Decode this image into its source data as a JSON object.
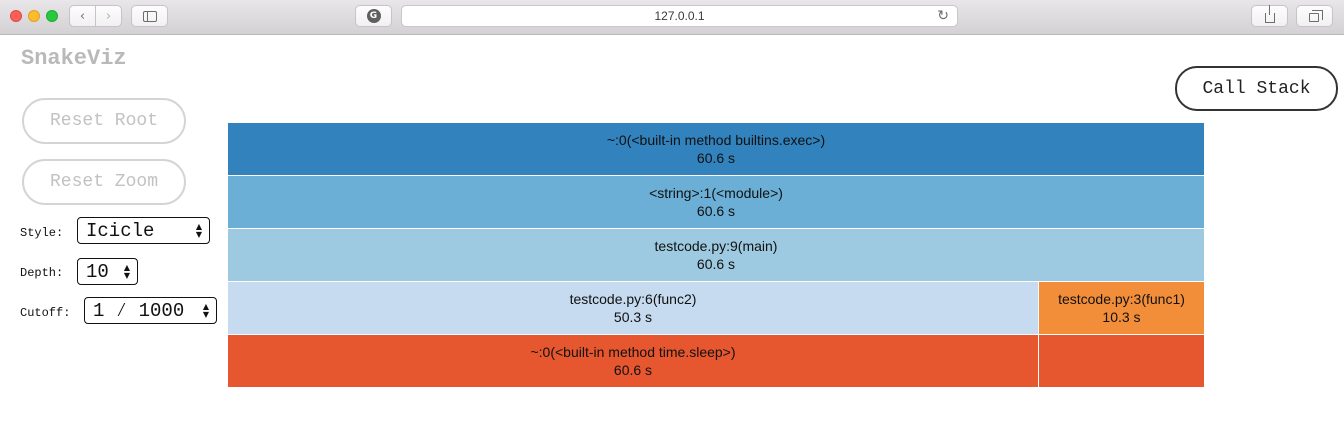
{
  "browser": {
    "address": "127.0.0.1",
    "back_icon": "‹",
    "forward_icon": "›",
    "reload_icon": "↻",
    "extension_letter": "G"
  },
  "app": {
    "title": "SnakeViz",
    "reset_root_label": "Reset Root",
    "reset_zoom_label": "Reset Zoom",
    "call_stack_label": "Call Stack"
  },
  "controls": {
    "style": {
      "label": "Style:",
      "value": "Icicle"
    },
    "depth": {
      "label": "Depth:",
      "value": "10"
    },
    "cutoff": {
      "label": "Cutoff:",
      "value": "1 ⁄ 1000"
    }
  },
  "icicle": {
    "total_seconds": 60.6,
    "rows": [
      [
        {
          "name": "~:0(<built-in method builtins.exec>)",
          "time": "60.6 s",
          "seconds": 60.6,
          "color": "#3182bd"
        }
      ],
      [
        {
          "name": "<string>:1(<module>)",
          "time": "60.6 s",
          "seconds": 60.6,
          "color": "#6baed6"
        }
      ],
      [
        {
          "name": "testcode.py:9(main)",
          "time": "60.6 s",
          "seconds": 60.6,
          "color": "#9ecae1"
        }
      ],
      [
        {
          "name": "testcode.py:6(func2)",
          "time": "50.3 s",
          "seconds": 50.3,
          "color": "#c6dbef"
        },
        {
          "name": "testcode.py:3(func1)",
          "time": "10.3 s",
          "seconds": 10.3,
          "color": "#f28e3a"
        }
      ],
      [
        {
          "name": "~:0(<built-in method time.sleep>)",
          "time": "60.6 s",
          "seconds": 50.3,
          "color": "#e6562f"
        },
        {
          "name": "",
          "time": "",
          "seconds": 10.3,
          "color": "#e6562f"
        }
      ]
    ]
  }
}
